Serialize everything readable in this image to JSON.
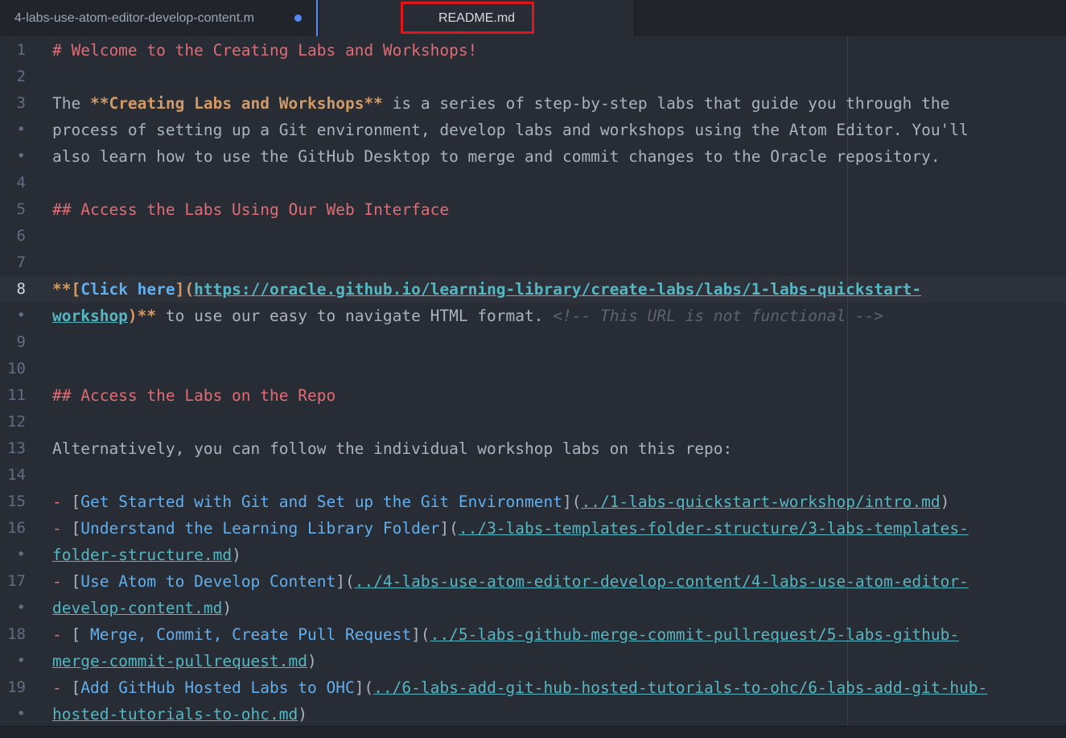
{
  "tabs": [
    {
      "label": "4-labs-use-atom-editor-develop-content.m",
      "modified": true
    },
    {
      "label": "README.md",
      "active": true
    }
  ],
  "gutter": [
    "1",
    "2",
    "3",
    "•",
    "•",
    "4",
    "5",
    "6",
    "7",
    "8",
    "•",
    "9",
    "10",
    "11",
    "12",
    "13",
    "14",
    "15",
    "16",
    "•",
    "17",
    "•",
    "18",
    "•",
    "19",
    "•"
  ],
  "active_line": "8",
  "lines": {
    "l1": "# Welcome to the Creating Labs and Workshops!",
    "l3_a": "The ",
    "l3_b": "**Creating Labs and Workshops**",
    "l3_c": " is a series of step-by-step labs that guide you through the",
    "l3w1": "process of setting up a Git environment, develop labs and workshops using the Atom Editor. You'll",
    "l3w2": "also learn how to use the GitHub Desktop to merge and commit changes to the Oracle repository.",
    "l5": "## Access the Labs Using Our Web Interface",
    "l8_a": "**[",
    "l8_b": "Click here",
    "l8_c": "](",
    "l8_d": "https://oracle.github.io/learning-library/create-labs/labs/1-labs-quickstart-",
    "l8w_a": "workshop",
    "l8w_b": ")**",
    "l8w_c": " to use our easy to navigate HTML format. ",
    "l8w_d": "<!-- This URL is not functional -->",
    "l11": "## Access the Labs on the Repo",
    "l13": "Alternatively, you can follow the individual workshop labs on this repo:",
    "l15_dash": "- ",
    "l15_o": "[",
    "l15_t": "Get Started with Git and Set up the Git Environment",
    "l15_m": "](",
    "l15_u": "../1-labs-quickstart-workshop/intro.md",
    "l15_c": ")",
    "l16_dash": "- ",
    "l16_o": "[",
    "l16_t": "Understand the Learning Library Folder",
    "l16_m": "](",
    "l16_u": "../3-labs-templates-folder-structure/3-labs-templates-",
    "l16w_u": "folder-structure.md",
    "l16w_c": ")",
    "l17_dash": "- ",
    "l17_o": "[",
    "l17_t": "Use Atom to Develop Content",
    "l17_m": "](",
    "l17_u": "../4-labs-use-atom-editor-develop-content/4-labs-use-atom-editor-",
    "l17w_u": "develop-content.md",
    "l17w_c": ")",
    "l18_dash": "- ",
    "l18_o": "[",
    "l18_t": " Merge, Commit, Create Pull Request",
    "l18_m": "](",
    "l18_u": "../5-labs-github-merge-commit-pullrequest/5-labs-github-",
    "l18w_u": "merge-commit-pullrequest.md",
    "l18w_c": ")",
    "l19_dash": "- ",
    "l19_o": "[",
    "l19_t": "Add GitHub Hosted Labs to OHC",
    "l19_m": "](",
    "l19_u": "../6-labs-add-git-hub-hosted-tutorials-to-ohc/6-labs-add-git-hub-",
    "l19w_u": "hosted-tutorials-to-ohc.md",
    "l19w_c": ")"
  },
  "colors": {
    "editor_bg": "#282c34",
    "heading": "#e06c75",
    "bold": "#d19a66",
    "link_text": "#61afef",
    "url": "#56b6c2",
    "comment": "#5c6370",
    "annotation_box": "#e2141c",
    "modified_dot": "#568af2"
  }
}
